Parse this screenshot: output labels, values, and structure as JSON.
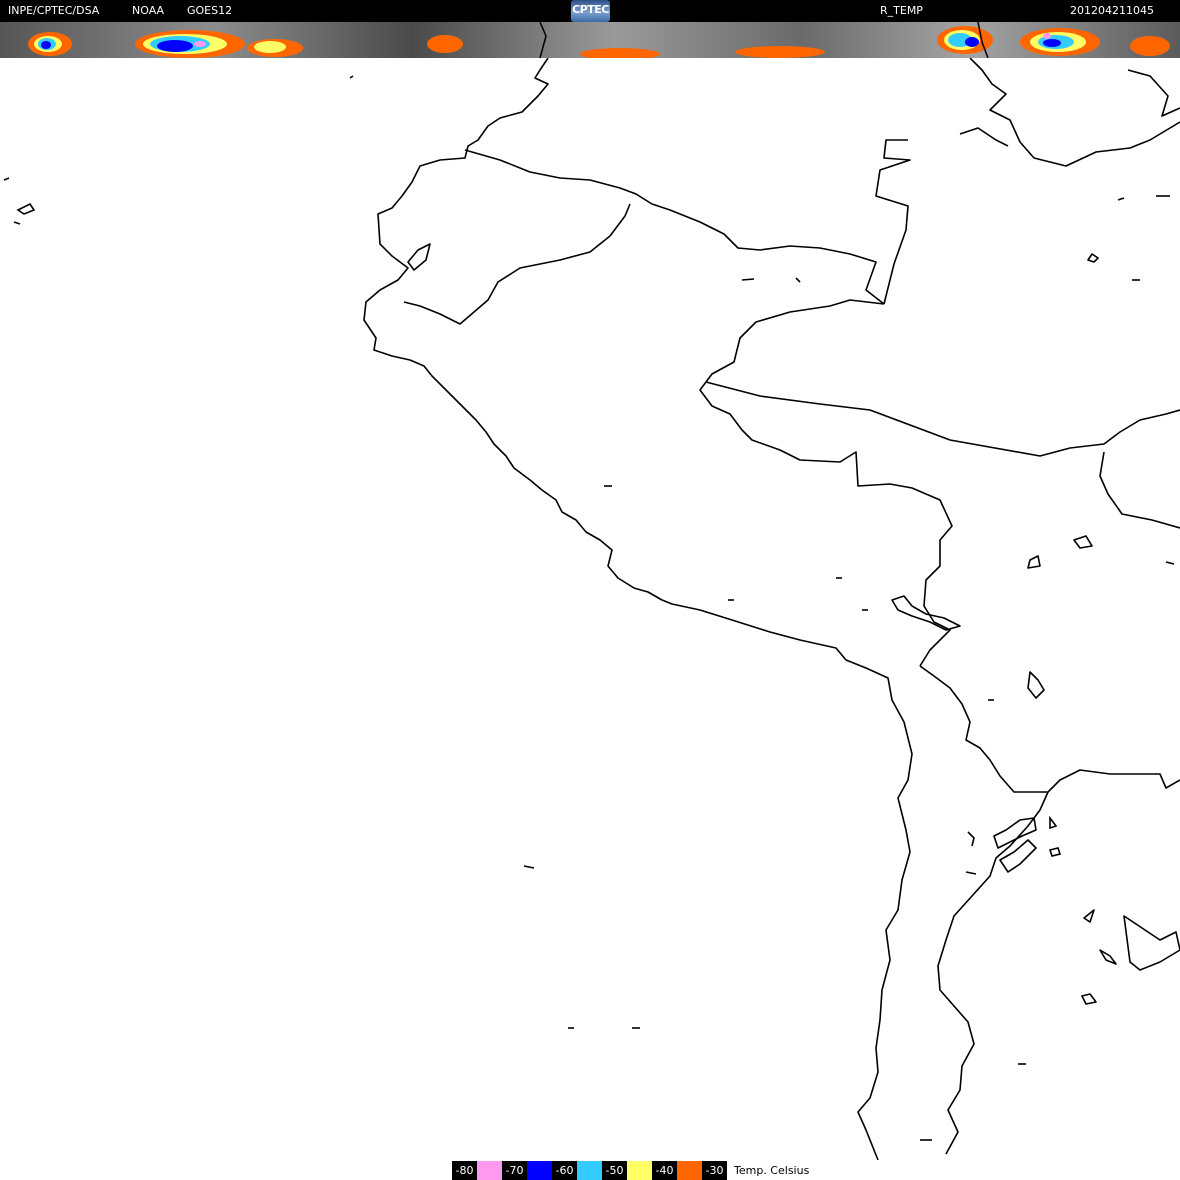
{
  "header": {
    "source": "INPE/CPTEC/DSA",
    "agency": "NOAA",
    "satellite": "GOES12",
    "logo": "CPTEC",
    "product": "R_TEMP",
    "timestamp": "201204211045"
  },
  "legend": {
    "unit": "Temp. Celsius",
    "items": [
      {
        "label": "-80",
        "color": "#000000"
      },
      {
        "label": "",
        "color": "#ff99ee"
      },
      {
        "label": "-70",
        "color": "#000000"
      },
      {
        "label": "",
        "color": "#0000ff"
      },
      {
        "label": "-60",
        "color": "#000000"
      },
      {
        "label": "",
        "color": "#33ccff"
      },
      {
        "label": "-50",
        "color": "#000000"
      },
      {
        "label": "",
        "color": "#ffff66"
      },
      {
        "label": "-40",
        "color": "#000000"
      },
      {
        "label": "",
        "color": "#ff6600"
      },
      {
        "label": "-30",
        "color": "#000000"
      }
    ]
  },
  "colors": {
    "background": "#ffffff",
    "coastline": "#000000",
    "header_bg": "#000000",
    "header_text": "#ffffff"
  }
}
